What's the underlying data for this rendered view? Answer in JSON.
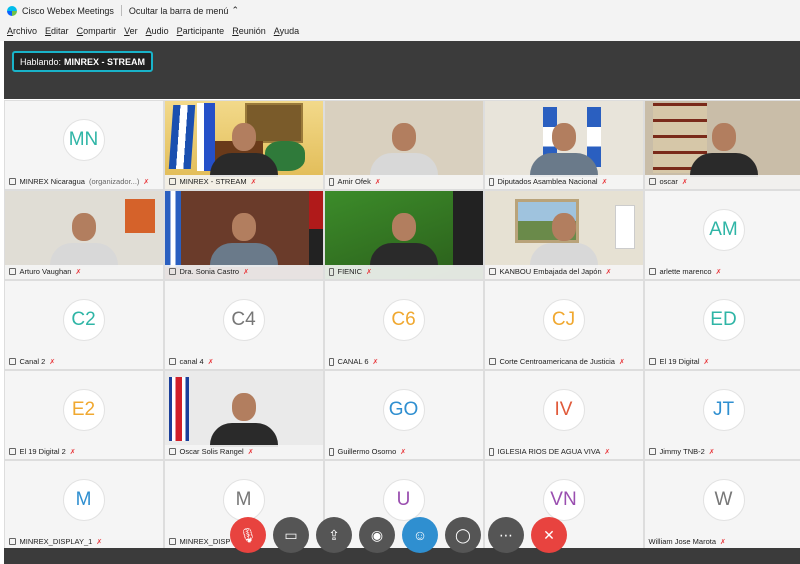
{
  "window": {
    "title": "Cisco Webex Meetings",
    "hide_menu_label": "Ocultar la barra de menú",
    "hide_menu_icon": "chevron-up-icon"
  },
  "menu": {
    "items": [
      "Archivo",
      "Editar",
      "Compartir",
      "Ver",
      "Audio",
      "Participante",
      "Reunión",
      "Ayuda"
    ]
  },
  "speaking": {
    "prefix": "Hablando:",
    "name": "MINREX - STREAM"
  },
  "participants": [
    {
      "initials": "MN",
      "color": "#2fb5a6",
      "name": "MINREX Nicaragua",
      "sub": "(organizador...)",
      "mode": "avatar",
      "device": "mic"
    },
    {
      "name": "MINREX - STREAM",
      "mode": "video",
      "device": "pc",
      "active": true,
      "scene": "podium"
    },
    {
      "name": "Amir Ofek",
      "mode": "video",
      "device": "phone",
      "scene": "office"
    },
    {
      "name": "Diputados Asamblea Nacional",
      "mode": "video",
      "device": "phone",
      "scene": "flags"
    },
    {
      "name": "oscar",
      "mode": "video",
      "device": "mic",
      "scene": "bookshelf"
    },
    {
      "name": "Arturo Vaughan",
      "mode": "video",
      "device": "mic",
      "scene": "office2"
    },
    {
      "name": "Dra. Sonia Castro",
      "mode": "video",
      "device": "mic",
      "scene": "flag-desk"
    },
    {
      "name": "FIENIC",
      "mode": "video",
      "device": "phone",
      "scene": "green"
    },
    {
      "name": "KANBOU Embajada del Japón",
      "mode": "video",
      "device": "mic",
      "scene": "painting"
    },
    {
      "initials": "AM",
      "color": "#2fb5a6",
      "name": "arlette marenco",
      "mode": "avatar",
      "device": "mic"
    },
    {
      "initials": "C2",
      "color": "#2fb5a6",
      "name": "Canal 2",
      "mode": "avatar",
      "device": "mic"
    },
    {
      "initials": "C4",
      "color": "#777777",
      "name": "canal 4",
      "mode": "avatar",
      "device": "mic"
    },
    {
      "initials": "C6",
      "color": "#f0a830",
      "name": "CANAL 6",
      "mode": "avatar",
      "device": "phone"
    },
    {
      "initials": "CJ",
      "color": "#f0a830",
      "name": "Corte Centroamericana de Justicia",
      "mode": "avatar",
      "device": "mic"
    },
    {
      "initials": "ED",
      "color": "#2fb5a6",
      "name": "El 19 Digital",
      "mode": "avatar",
      "device": "mic"
    },
    {
      "initials": "E2",
      "color": "#f0a830",
      "name": "El 19 Digital 2",
      "mode": "avatar",
      "device": "mic"
    },
    {
      "name": "Oscar Solis Rangel",
      "mode": "video",
      "device": "mic",
      "scene": "cr-flag"
    },
    {
      "initials": "GO",
      "color": "#2f8fd0",
      "name": "Guillermo Osorno",
      "mode": "avatar",
      "device": "phone"
    },
    {
      "initials": "IV",
      "color": "#e05a3a",
      "name": "IGLESIA RIOS DE AGUA VIVA",
      "mode": "avatar",
      "device": "phone"
    },
    {
      "initials": "JT",
      "color": "#2f8fd0",
      "name": "Jimmy TNB-2",
      "mode": "avatar",
      "device": "mic"
    },
    {
      "initials": "M",
      "color": "#2f8fd0",
      "name": "MINREX_DISPLAY_1",
      "mode": "avatar",
      "device": "mic"
    },
    {
      "initials": "M",
      "color": "#777777",
      "name": "MINREX_DISP",
      "mode": "avatar",
      "device": "mic"
    },
    {
      "initials": "U",
      "color": "#9a4fb0",
      "name": "",
      "mode": "avatar",
      "device": "none"
    },
    {
      "initials": "VN",
      "color": "#9a4fb0",
      "name": "",
      "mode": "avatar",
      "device": "none"
    },
    {
      "initials": "W",
      "color": "#777777",
      "name": "William Jose Marota",
      "mode": "avatar",
      "device": "none"
    }
  ],
  "toolbar": [
    {
      "name": "mute-button",
      "icon": "muted-mic-icon",
      "color": "#e8433f",
      "glyph": "🎙"
    },
    {
      "name": "stop-video-button",
      "icon": "video-off-icon",
      "color": "#555555",
      "glyph": "▭"
    },
    {
      "name": "share-button",
      "icon": "share-icon",
      "color": "#555555",
      "glyph": "⇪"
    },
    {
      "name": "record-button",
      "icon": "record-icon",
      "color": "#555555",
      "glyph": "◉"
    },
    {
      "name": "participants-button",
      "icon": "participants-icon",
      "color": "#2f8fd0",
      "glyph": "☺"
    },
    {
      "name": "chat-button",
      "icon": "chat-icon",
      "color": "#555555",
      "glyph": "◯"
    },
    {
      "name": "more-button",
      "icon": "more-icon",
      "color": "#555555",
      "glyph": "⋯"
    },
    {
      "name": "leave-button",
      "icon": "close-icon",
      "color": "#e8433f",
      "glyph": "✕"
    }
  ]
}
